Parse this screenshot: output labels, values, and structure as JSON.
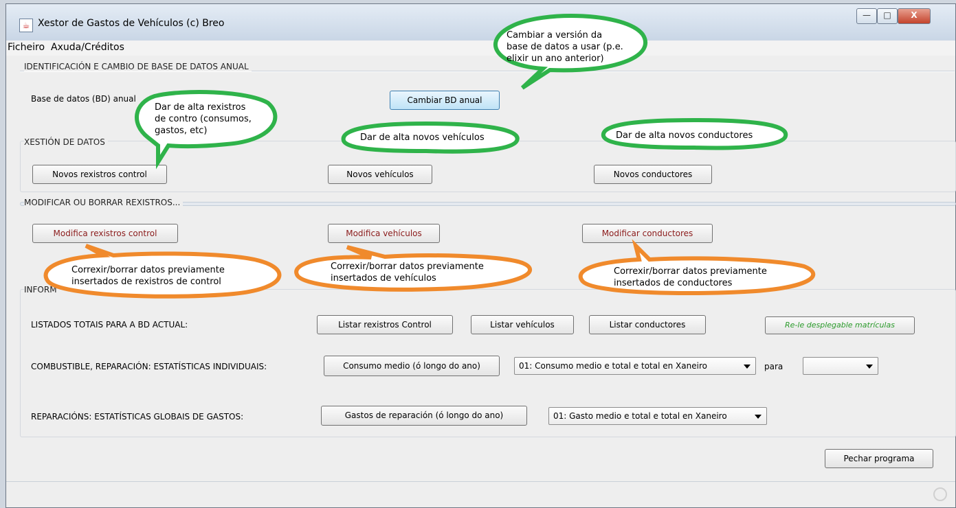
{
  "window": {
    "title": "Xestor de Gastos de Vehículos (c) Breo",
    "minimize": "—",
    "maximize": "□",
    "close": "X"
  },
  "menu": [
    "Ficheiro",
    "Axuda/Créditos"
  ],
  "sections": {
    "identificacion": {
      "title": "IDENTIFICACIÓN E CAMBIO DE BASE DE DATOS ANUAL",
      "label": "Base de datos (BD) anual",
      "button": "Cambiar BD anual"
    },
    "xestion": {
      "title": "XESTIÓN DE DATOS",
      "buttons": [
        "Novos rexistros control",
        "Novos vehículos",
        "Novos conductores"
      ]
    },
    "modificar": {
      "title": "MODIFICAR OU BORRAR REXISTROS...",
      "buttons": [
        "Modifica rexistros control",
        "Modifica vehículos",
        "Modificar conductores"
      ]
    },
    "informes": {
      "title": "INFORM",
      "listados_label": "LISTADOS TOTAIS PARA A BD ACTUAL:",
      "listados_buttons": [
        "Listar rexistros Control",
        "Listar vehículos",
        "Listar conductores"
      ],
      "rele_button": "Re-le desplegable matrículas",
      "combustible_label": "COMBUSTIBLE, REPARACIÓN: ESTATÍSTICAS INDIVIDUAIS:",
      "consumo_button": "Consumo medio (ó longo do ano)",
      "consumo_select": "01: Consumo medio e total e total en Xaneiro",
      "para_label": "para",
      "para_select": "",
      "reparacions_label": "REPARACIÓNS: ESTATÍSTICAS GLOBAIS DE GASTOS:",
      "gastos_button": "Gastos de reparación (ó longo do ano)",
      "gastos_select": "01: Gasto medio e total e total en Xaneiro"
    }
  },
  "close_program": "Pechar programa",
  "annotations": {
    "green": [
      {
        "lines": [
          "Cambiar a versión da",
          "base de datos a usar (p.e.",
          "elixir un ano anterior)"
        ]
      },
      {
        "lines": [
          "Dar de alta rexistros",
          "de contro (consumos,",
          "gastos, etc)"
        ]
      },
      {
        "lines": [
          "Dar de alta novos vehículos"
        ]
      },
      {
        "lines": [
          "Dar de alta novos conductores"
        ]
      }
    ],
    "orange": [
      {
        "lines": [
          "Correxir/borrar datos previamente",
          "insertados de rexistros de control"
        ]
      },
      {
        "lines": [
          "Correxir/borrar datos previamente",
          "insertados de vehículos"
        ]
      },
      {
        "lines": [
          "Correxir/borrar datos previamente",
          "insertados de conductores"
        ]
      }
    ],
    "colors": {
      "green": "#2fb34a",
      "orange": "#f08a2c"
    }
  }
}
